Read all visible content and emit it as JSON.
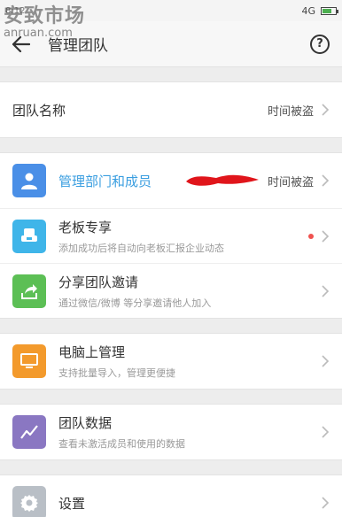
{
  "status_bar": {
    "left_text": "8:12",
    "right_text": "4G"
  },
  "watermark": {
    "title": "安致市场",
    "site": "anruan.com"
  },
  "header": {
    "title": "管理团队",
    "help_icon": "help-icon"
  },
  "team_name": {
    "label": "团队名称",
    "value": "时间被盗"
  },
  "menu_groups": [
    {
      "items": [
        {
          "label": "管理部门和成员",
          "desc": "",
          "value": "时间被盗",
          "icon": "person-icon",
          "color": "#4a8fe7",
          "accent": true
        },
        {
          "label": "老板专享",
          "desc": "添加成功后将自动向老板汇报企业动态",
          "value": "",
          "icon": "boss-chair-icon",
          "color": "#3fb5e9",
          "badge": true
        },
        {
          "label": "分享团队邀请",
          "desc": "通过微信/微博 等分享邀请他人加入",
          "value": "",
          "icon": "share-icon",
          "color": "#5cbf55"
        }
      ]
    },
    {
      "items": [
        {
          "label": "电脑上管理",
          "desc": "支持批量导入，管理更便捷",
          "value": "",
          "icon": "monitor-icon",
          "color": "#f39a2c"
        }
      ]
    },
    {
      "items": [
        {
          "label": "团队数据",
          "desc": "查看未激活成员和使用的数据",
          "value": "",
          "icon": "chart-icon",
          "color": "#8a77c2"
        }
      ]
    },
    {
      "items": [
        {
          "label": "设置",
          "desc": "",
          "value": "",
          "icon": "gear-icon",
          "color": "#b9bfc6"
        }
      ]
    }
  ]
}
